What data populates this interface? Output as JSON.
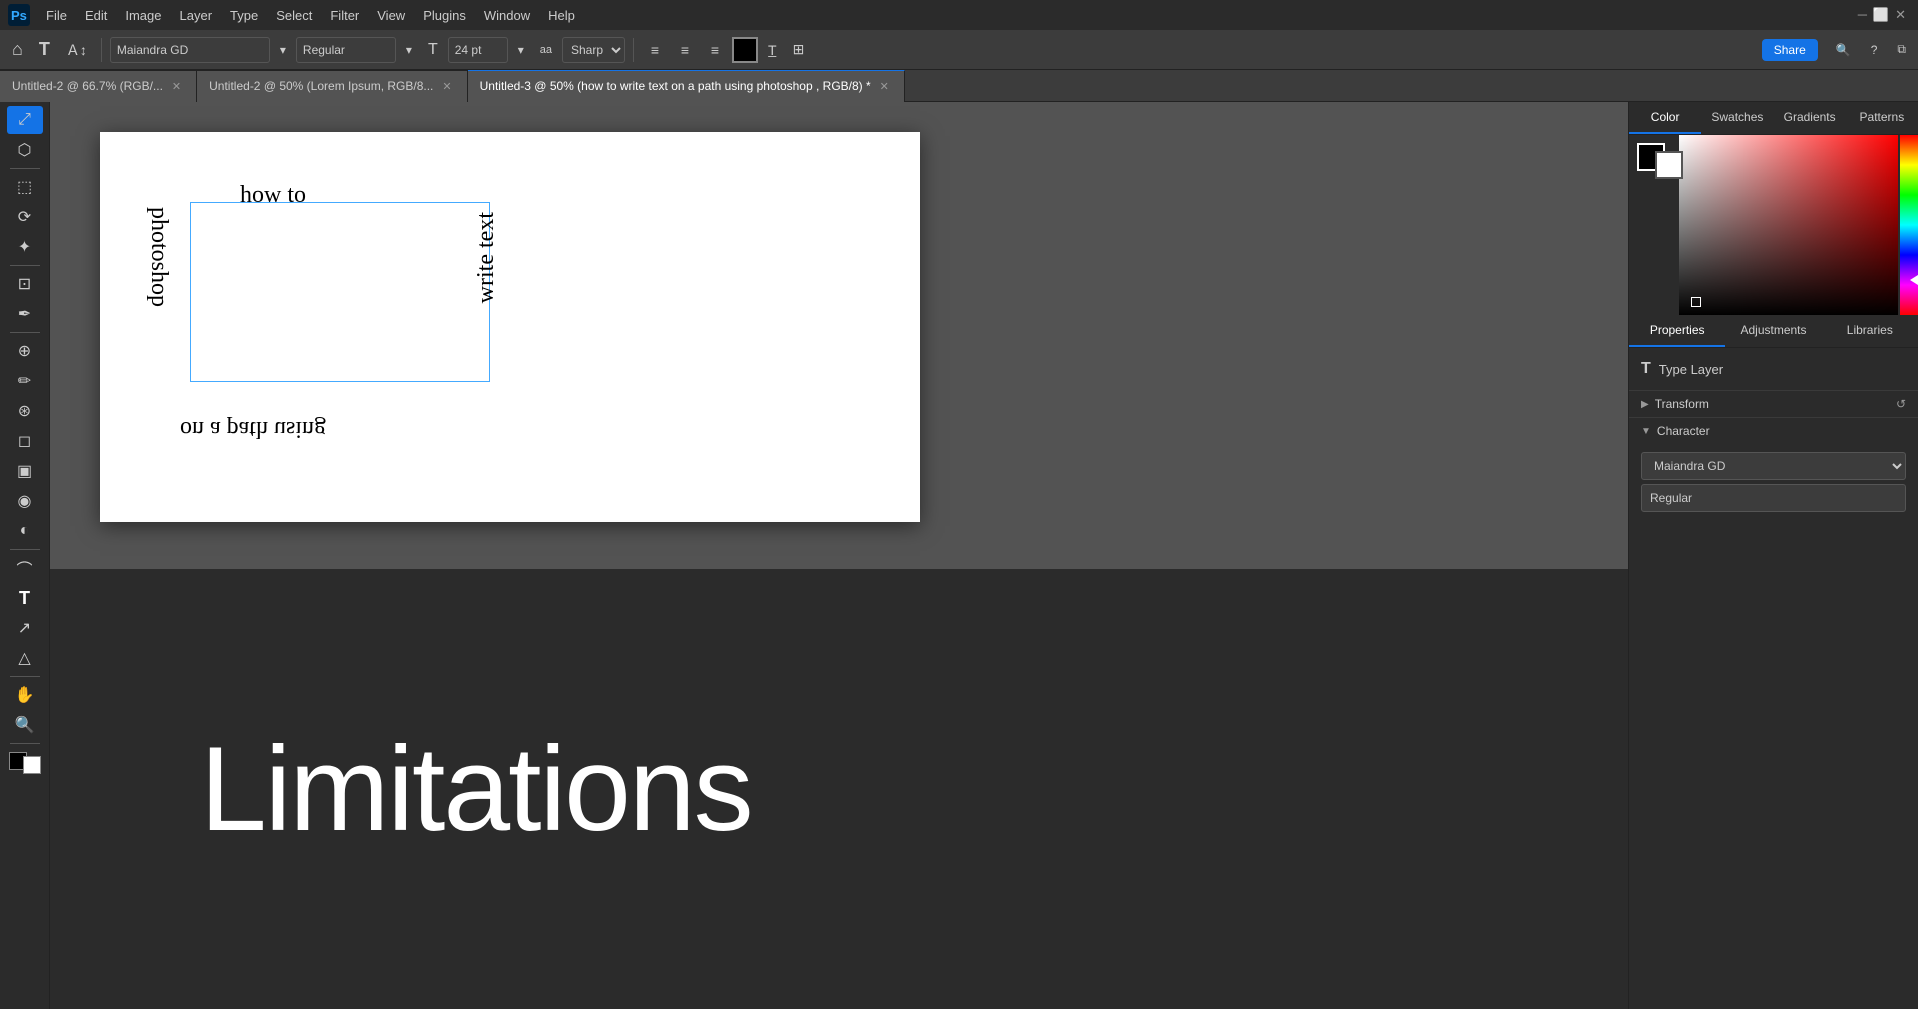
{
  "app": {
    "name": "Adobe Photoshop"
  },
  "menubar": {
    "items": [
      "File",
      "Edit",
      "Image",
      "Layer",
      "Type",
      "Select",
      "Filter",
      "View",
      "Plugins",
      "Window",
      "Help"
    ]
  },
  "toolbar": {
    "font_name": "Maiandra GD",
    "font_style": "Regular",
    "font_size": "24 pt",
    "antialiasing": "Sharp",
    "text_color": "#000000",
    "share_label": "Share"
  },
  "tabs": [
    {
      "label": "Untitled-2 @ 66.7% (RGB/...",
      "active": false
    },
    {
      "label": "Untitled-2 @ 50% (Lorem Ipsum, RGB/8...",
      "active": false
    },
    {
      "label": "Untitled-3 @ 50% (how to  write text on a path using   photoshop , RGB/8) *",
      "active": true
    }
  ],
  "canvas": {
    "text_top": "how to",
    "text_right": "write text",
    "text_bottom": "on a path using",
    "text_left": "photoshop"
  },
  "overlay": {
    "title": "Limitations"
  },
  "color_panel": {
    "tabs": [
      "Color",
      "Swatches",
      "Gradients",
      "Patterns"
    ]
  },
  "properties_panel": {
    "tabs": [
      "Properties",
      "Adjustments",
      "Libraries"
    ],
    "type_layer_label": "Type Layer",
    "transform_label": "Transform",
    "character_label": "Character",
    "font_name": "Maiandra GD",
    "font_style": "Regular"
  },
  "tools": {
    "icons": [
      "↔",
      "↕",
      "⟳",
      "✂",
      "⬡",
      "⬟",
      "✏",
      "⬚",
      "⊕",
      "◉",
      "T",
      "↗",
      "∿",
      "△",
      "⬤",
      "⬛"
    ]
  }
}
